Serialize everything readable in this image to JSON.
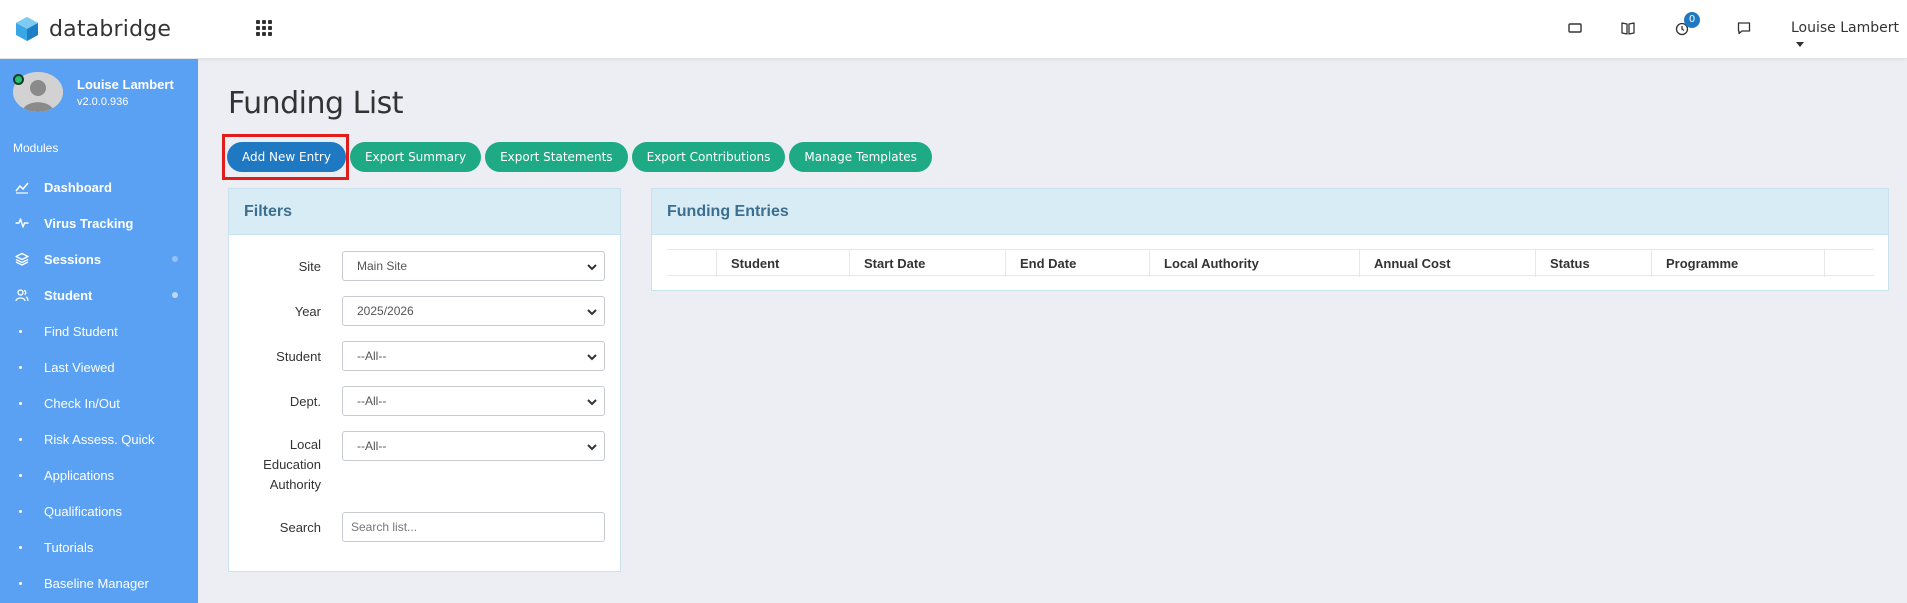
{
  "app": {
    "brand": "databridge",
    "user_menu_label": "Louise Lambert",
    "notification_count": "0"
  },
  "sidebar": {
    "profile_name": "Louise Lambert",
    "profile_version": "v2.0.0.936",
    "modules_label": "Modules",
    "items": [
      {
        "label": "Dashboard",
        "icon": "chart-line-icon"
      },
      {
        "label": "Virus Tracking",
        "icon": "pulse-icon"
      },
      {
        "label": "Sessions",
        "icon": "layers-icon"
      },
      {
        "label": "Student",
        "icon": "users-icon"
      }
    ],
    "subitems": [
      "Find Student",
      "Last Viewed",
      "Check In/Out",
      "Risk Assess. Quick",
      "Applications",
      "Qualifications",
      "Tutorials",
      "Baseline Manager"
    ]
  },
  "page": {
    "title": "Funding List"
  },
  "actions": {
    "add_new": "Add New Entry",
    "export_summary": "Export Summary",
    "export_statements": "Export Statements",
    "export_contributions": "Export Contributions",
    "manage_templates": "Manage Templates"
  },
  "filters": {
    "title": "Filters",
    "site_label": "Site",
    "site_value": "Main Site",
    "year_label": "Year",
    "year_value": "2025/2026",
    "student_label": "Student",
    "student_value": "--All--",
    "dept_label": "Dept.",
    "dept_value": "--All--",
    "lea_label": "Local Education Authority",
    "lea_value": "--All--",
    "search_label": "Search",
    "search_placeholder": "Search list..."
  },
  "entries": {
    "title": "Funding Entries",
    "columns": [
      "Student",
      "Start Date",
      "End Date",
      "Local Authority",
      "Annual Cost",
      "Status",
      "Programme"
    ]
  },
  "colors": {
    "sidebar": "#5aa1f3",
    "primary": "#1e78c2",
    "success": "#1eaa84",
    "panel_header": "#d8ecf6",
    "highlight": "#e21b1b"
  }
}
